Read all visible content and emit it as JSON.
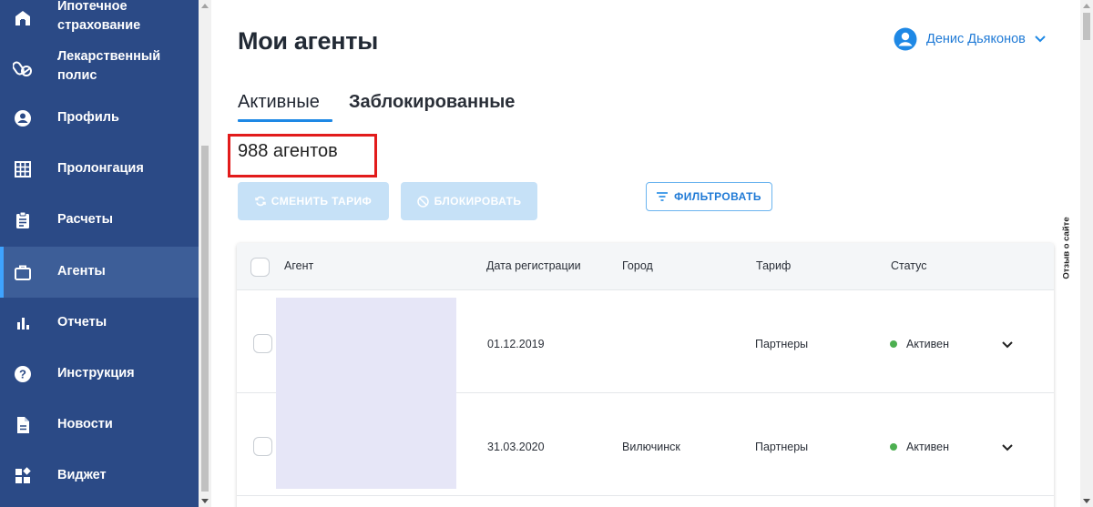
{
  "sidebar": {
    "items": [
      {
        "label": "Ипотечное страхование",
        "icon": "house-icon"
      },
      {
        "label": "Лекарственный полис",
        "icon": "pills-icon"
      },
      {
        "label": "Профиль",
        "icon": "account-circle-icon"
      },
      {
        "label": "Пролонгация",
        "icon": "grid-icon"
      },
      {
        "label": "Расчеты",
        "icon": "clipboard-icon"
      },
      {
        "label": "Агенты",
        "icon": "briefcase-icon",
        "active": true
      },
      {
        "label": "Отчеты",
        "icon": "bar-chart-icon"
      },
      {
        "label": "Инструкция",
        "icon": "help-circle-icon"
      },
      {
        "label": "Новости",
        "icon": "document-icon"
      },
      {
        "label": "Виджет",
        "icon": "widgets-icon"
      }
    ]
  },
  "header": {
    "title": "Мои агенты",
    "user_name": "Денис Дьяконов"
  },
  "tabs": [
    {
      "label": "Активные",
      "active": true
    },
    {
      "label": "Заблокированные",
      "active": false
    }
  ],
  "count_text": "988 агентов",
  "actions": {
    "change_tariff": "СМЕНИТЬ ТАРИФ",
    "block": "БЛОКИРОВАТЬ",
    "filter": "ФИЛЬТРОВАТЬ"
  },
  "table": {
    "columns": [
      "Агент",
      "Дата регистрации",
      "Город",
      "Тариф",
      "Статус"
    ],
    "rows": [
      {
        "date": "01.12.2019",
        "city": "",
        "tariff": "Партнеры",
        "status": "Активен"
      },
      {
        "date": "31.03.2020",
        "city": "Вилючинск",
        "tariff": "Партнеры",
        "status": "Активен"
      }
    ]
  },
  "feedback_label": "Отзыв о сайте",
  "colors": {
    "sidebar_bg": "#2b4a86",
    "sidebar_active": "#3d5e98",
    "accent": "#1e88e5",
    "status_active": "#4caf50",
    "highlight": "#e21b1b"
  }
}
